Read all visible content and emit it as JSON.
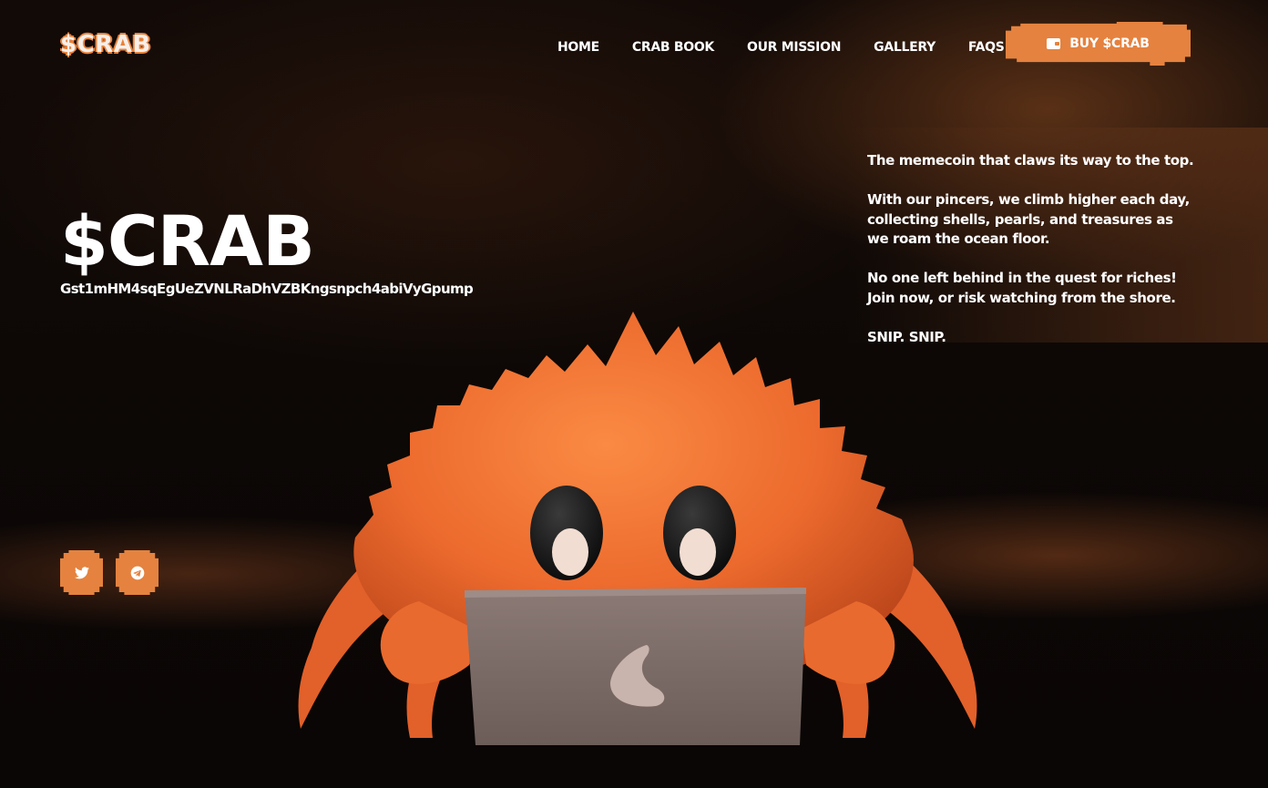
{
  "header": {
    "logo_text": "$CRAB",
    "nav": [
      {
        "label": "HOME"
      },
      {
        "label": "CRAB BOOK"
      },
      {
        "label": "OUR MISSION"
      },
      {
        "label": "GALLERY"
      },
      {
        "label": "FAQS"
      }
    ],
    "buy_button_label": "BUY $CRAB",
    "buy_button_icon": "wallet-icon"
  },
  "hero": {
    "title": "$CRAB",
    "contract_address": "Gst1mHM4sqEgUeZVNLRaDhVZBKngsnpch4abiVyGpump",
    "tagline": [
      "The memecoin that claws its way to the top.",
      "With our pincers, we climb higher each day, collecting shells, pearls, and treasures as we roam the ocean floor.",
      "No one left behind in the quest for riches! Join now, or risk watching from the shore.",
      "SNIP. SNIP."
    ]
  },
  "socials": [
    {
      "name": "twitter",
      "icon": "twitter-icon"
    },
    {
      "name": "telegram",
      "icon": "telegram-icon"
    }
  ],
  "colors": {
    "accent": "#e5823f",
    "background": "#0b0706",
    "text": "#ffffff",
    "crab_body": "#ee6a2c",
    "laptop": "#7a6a66"
  }
}
